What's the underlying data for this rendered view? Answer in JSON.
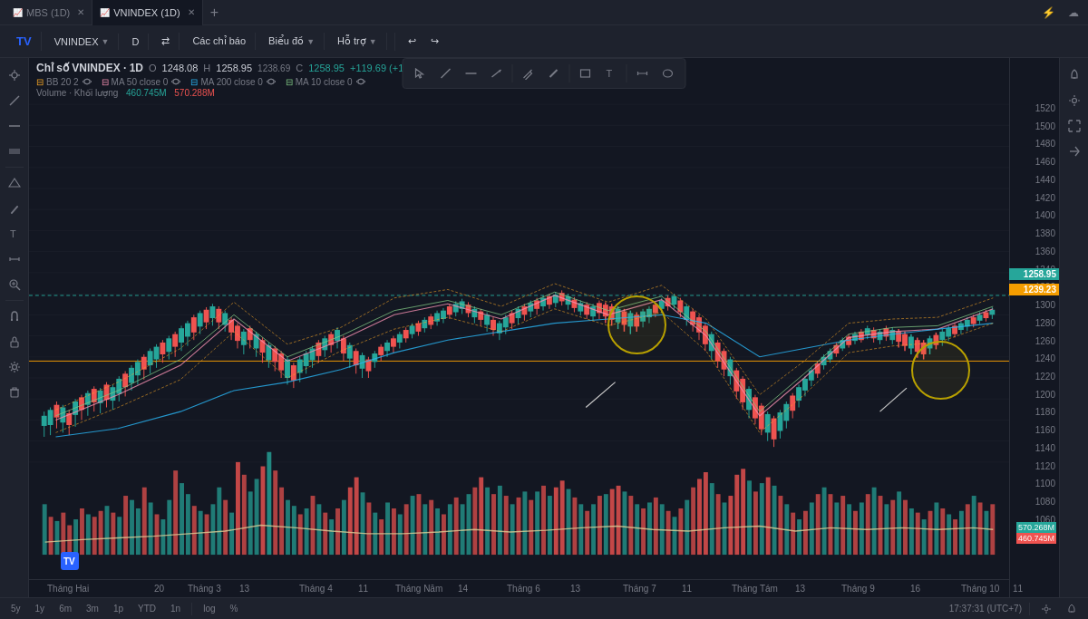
{
  "tabs": {
    "items": [
      {
        "label": "MBS (1D)",
        "active": false,
        "closeable": true
      },
      {
        "label": "VNINDEX (1D)",
        "active": true,
        "closeable": true
      }
    ],
    "add_label": "+",
    "right_buttons": [
      "⚡",
      "☁"
    ]
  },
  "toolbar": {
    "symbol": "VNINDEX",
    "timeframe": "D",
    "compare_icon": "⇄",
    "indicators_label": "Các chỉ báo",
    "display_label": "Biểu đồ",
    "more_label": "Hỗ trợ",
    "undo_label": "↩",
    "redo_label": "↪"
  },
  "chart": {
    "title": "Chỉ số VNINDEX · 1D",
    "ohlc": {
      "o_label": "O",
      "o_val": "1248.08",
      "h_label": "H",
      "h_val": "1258.95",
      "h_val2": "1238.69",
      "c_label": "C",
      "c_val": "1258.95",
      "change": "+119.69 (+11.59%)"
    },
    "volume_label": "Volume · Khối lượng",
    "volume_val": "460.745M",
    "volume_val2": "570.288M",
    "indicators": [
      {
        "name": "BB 20 2",
        "color": "#f9a825"
      },
      {
        "name": "MA 50 close 0",
        "color": "#f48fb1"
      },
      {
        "name": "MA 200 close 0",
        "color": "#29b6f6"
      },
      {
        "name": "MA 10 close 0",
        "color": "#81c784"
      }
    ],
    "price_levels": {
      "current": "1258.95",
      "orange_line": "1239.23",
      "volume_top": "570.268M",
      "volume_bottom": "460.745M"
    },
    "price_axis": [
      "1520",
      "1500",
      "1480",
      "1460",
      "1440",
      "1420",
      "1400",
      "1380",
      "1360",
      "1340",
      "1320",
      "1300",
      "1280",
      "1260",
      "1240",
      "1220",
      "1200",
      "1180",
      "1160",
      "1140",
      "1120",
      "1100",
      "1080",
      "1060"
    ],
    "time_axis": [
      "Tháng Hai",
      "20",
      "Tháng 3",
      "13",
      "Tháng 4",
      "11",
      "Tháng Năm",
      "14",
      "Tháng 6",
      "13",
      "Tháng 7",
      "11",
      "Tháng Tám",
      "13",
      "Tháng 9",
      "16",
      "Tháng 10",
      "11"
    ]
  },
  "drawing_toolbar": {
    "tools": [
      {
        "name": "cursor",
        "icon": "⊹",
        "active": false
      },
      {
        "name": "line",
        "icon": "╱",
        "active": false
      },
      {
        "name": "hline",
        "icon": "—",
        "active": false
      },
      {
        "name": "ray",
        "icon": "⟶",
        "active": false
      },
      {
        "name": "pencil",
        "icon": "✏",
        "active": false
      },
      {
        "name": "brush",
        "icon": "⌇",
        "active": false
      },
      {
        "name": "rect",
        "icon": "▭",
        "active": false
      },
      {
        "name": "text",
        "icon": "T",
        "active": false
      },
      {
        "name": "measure",
        "icon": "⟺",
        "active": false
      },
      {
        "name": "ellipse",
        "icon": "○",
        "active": false
      }
    ]
  },
  "left_sidebar": {
    "tools": [
      {
        "name": "crosshair",
        "icon": "⊕"
      },
      {
        "name": "trend-line",
        "icon": "╱"
      },
      {
        "name": "horizontal-line",
        "icon": "—"
      },
      {
        "name": "fibonacci",
        "icon": "≋"
      },
      {
        "name": "pattern",
        "icon": "⬡"
      },
      {
        "name": "brush-tool",
        "icon": "🖊"
      },
      {
        "name": "text-tool",
        "icon": "T"
      },
      {
        "name": "measure-tool",
        "icon": "⟷"
      },
      {
        "name": "zoom-tool",
        "icon": "⊕"
      },
      {
        "name": "magnet",
        "icon": "⊞"
      },
      {
        "name": "lock",
        "icon": "🔒"
      },
      {
        "name": "settings2",
        "icon": "⚙"
      },
      {
        "name": "trash",
        "icon": "🗑"
      }
    ]
  },
  "right_sidebar": {
    "tools": [
      {
        "name": "alert",
        "icon": "🔔"
      },
      {
        "name": "settings",
        "icon": "⚙"
      },
      {
        "name": "fullscreen",
        "icon": "⛶"
      },
      {
        "name": "share",
        "icon": "↗"
      }
    ]
  },
  "status_bar": {
    "items": [
      "5y",
      "1y",
      "6m",
      "3m",
      "1p",
      "YTD",
      "1n"
    ],
    "time_label": "17:37:31 (UTC+7)",
    "right_items": [
      "⚙",
      "🔔"
    ]
  }
}
